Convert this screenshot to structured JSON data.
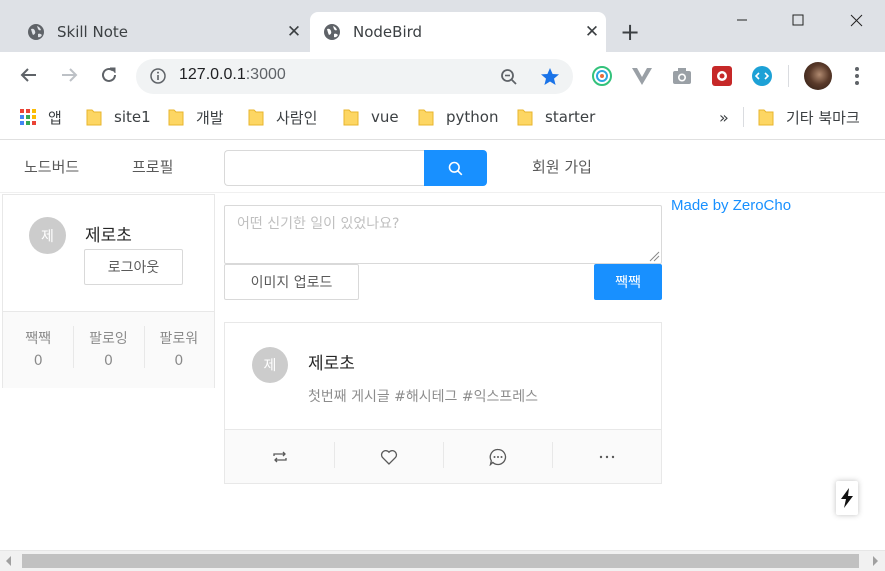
{
  "browser": {
    "tabs": [
      {
        "title": "Skill Note",
        "active": false,
        "favicon": "globe-icon"
      },
      {
        "title": "NodeBird",
        "active": true,
        "favicon": "globe-icon"
      }
    ],
    "url": {
      "host": "127.0.0.1",
      "port": ":3000"
    },
    "bookmarks": [
      {
        "label": "앱",
        "icon": "apps-grid-icon"
      },
      {
        "label": "site1",
        "icon": "folder-icon"
      },
      {
        "label": "개발",
        "icon": "folder-icon"
      },
      {
        "label": "사람인",
        "icon": "folder-icon"
      },
      {
        "label": "vue",
        "icon": "folder-icon"
      },
      {
        "label": "python",
        "icon": "folder-icon"
      },
      {
        "label": "starter",
        "icon": "folder-icon"
      }
    ],
    "bookmarks_overflow": "»",
    "other_bookmarks": "기타 북마크"
  },
  "menu": {
    "home": "노드버드",
    "profile": "프로필",
    "signup": "회원 가입",
    "search_placeholder": ""
  },
  "user": {
    "avatar_letter": "제",
    "name": "제로초",
    "logout": "로그아웃",
    "stats": [
      {
        "label": "짹짹",
        "value": "0"
      },
      {
        "label": "팔로잉",
        "value": "0"
      },
      {
        "label": "팔로워",
        "value": "0"
      }
    ]
  },
  "post_form": {
    "placeholder": "어떤 신기한 일이 있었나요?",
    "upload_label": "이미지 업로드",
    "submit_label": "짹짹"
  },
  "posts": [
    {
      "avatar_letter": "제",
      "author": "제로초",
      "content": "첫번째 게시글 #해시테그 #익스프레스",
      "actions": [
        "retweet-icon",
        "heart-icon",
        "comment-icon",
        "ellipsis-icon"
      ]
    }
  ],
  "made_by": "Made by ZeroCho",
  "colors": {
    "primary": "#1890ff",
    "tabstrip": "#dee1e6"
  }
}
